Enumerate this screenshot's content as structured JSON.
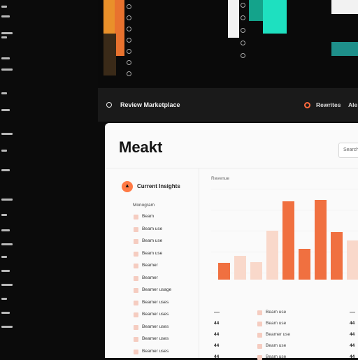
{
  "header": {
    "title": "Review Marketplace",
    "action_label": "Rewrites",
    "action2_label": "Ale"
  },
  "panel": {
    "title": "Meakt",
    "button_label": "Search",
    "warning_label": "Current Insights",
    "sub_label": "Monogram",
    "list_items": [
      "Beam",
      "Beam use",
      "Beam use",
      "Beam use",
      "Beamer",
      "Beamer",
      "Beamer usage",
      "Beamer uses",
      "Beamer uses",
      "Beamer uses",
      "Beamer uses",
      "Beamer uses"
    ]
  },
  "chart_data": {
    "type": "bar",
    "title": "",
    "label": "Revenue",
    "values": [
      24,
      34,
      25,
      70,
      112,
      44,
      114,
      68,
      56
    ],
    "highlighted": [
      true,
      false,
      false,
      false,
      true,
      true,
      true,
      true,
      false
    ],
    "colors": {
      "highlight": "#f07040",
      "muted": "#f9d8ca"
    }
  },
  "table": {
    "rows": [
      {
        "num": "",
        "text": "Beam use",
        "right": ""
      },
      {
        "num": "44",
        "text": "Beam use",
        "right": "44"
      },
      {
        "num": "44",
        "text": "Beamer use",
        "right": "44"
      },
      {
        "num": "44",
        "text": "Beam use",
        "right": "44"
      },
      {
        "num": "44",
        "text": "Beam use",
        "right": "44"
      }
    ]
  },
  "colors": {
    "accent": "#ff6a3d",
    "teal": "#1ee0c0",
    "amber": "#e9902a"
  }
}
